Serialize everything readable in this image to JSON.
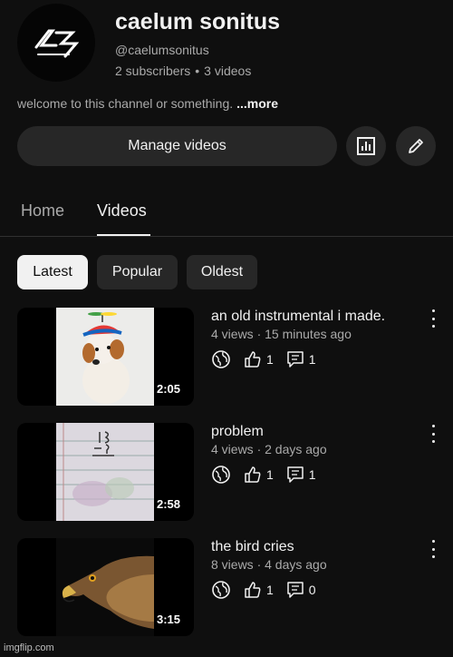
{
  "channel": {
    "name": "caelum sonitus",
    "handle": "@caelumsonitus",
    "subscribers": "2 subscribers",
    "separator": "•",
    "video_count": "3 videos",
    "description": "welcome to this channel or something.",
    "more_label": "...more"
  },
  "buttons": {
    "manage": "Manage videos",
    "analytics_icon": "bar-chart-icon",
    "edit_icon": "pencil-icon"
  },
  "tabs": [
    "Home",
    "Videos"
  ],
  "active_tab": "Videos",
  "chips": [
    "Latest",
    "Popular",
    "Oldest"
  ],
  "active_chip": "Latest",
  "videos": [
    {
      "title": "an old instrumental i made.",
      "meta": "4 views · 15 minutes ago",
      "duration": "2:05",
      "likes": "1",
      "comments": "1",
      "thumb": "dog-with-propeller-hat"
    },
    {
      "title": "problem",
      "meta": "4 views · 2 days ago",
      "duration": "2:58",
      "likes": "1",
      "comments": "1",
      "thumb": "handwritten-math-note"
    },
    {
      "title": "the bird cries",
      "meta": "8 views · 4 days ago",
      "duration": "3:15",
      "likes": "1",
      "comments": "0",
      "thumb": "eagle-head"
    }
  ],
  "watermark": "imgflip.com",
  "colors": {
    "background": "#0f0f0f",
    "surface": "#272727",
    "text": "#f1f1f1",
    "secondary": "#aaaaaa"
  }
}
